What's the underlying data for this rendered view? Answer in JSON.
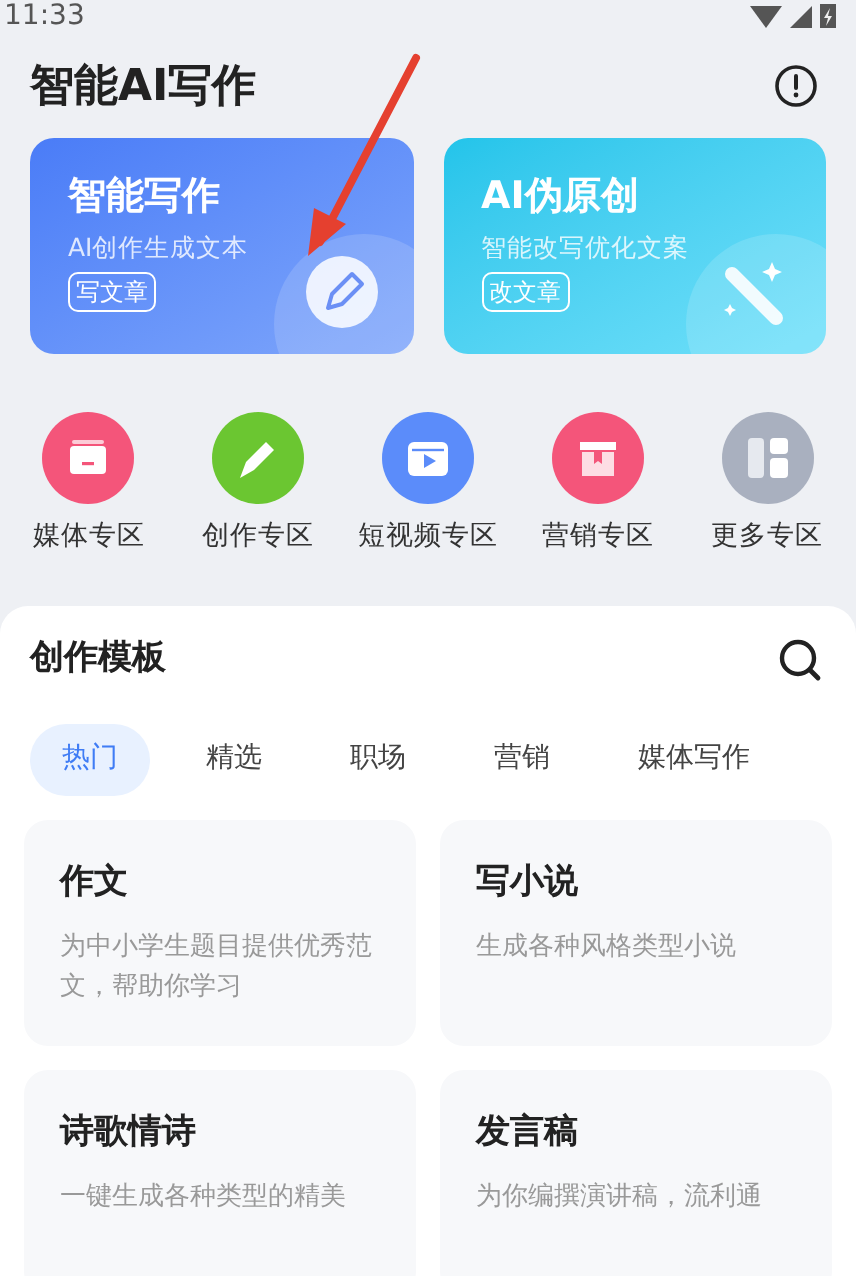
{
  "status_bar": {
    "time": "11:33"
  },
  "header": {
    "title": "智能AI写作"
  },
  "feature_cards": [
    {
      "kind": "write",
      "title": "智能写作",
      "subtitle": "AI创作生成文本",
      "action": "写文章"
    },
    {
      "kind": "rewrite",
      "title": "AI伪原创",
      "subtitle": "智能改写优化文案",
      "action": "改文章"
    }
  ],
  "zones": [
    {
      "kind": "media",
      "label": "媒体专区"
    },
    {
      "kind": "create",
      "label": "创作专区"
    },
    {
      "kind": "video",
      "label": "短视频专区"
    },
    {
      "kind": "marketing",
      "label": "营销专区"
    },
    {
      "kind": "more",
      "label": "更多专区"
    }
  ],
  "templates": {
    "title": "创作模板",
    "tabs": [
      {
        "label": "热门",
        "selected": true
      },
      {
        "label": "精选",
        "selected": false
      },
      {
        "label": "职场",
        "selected": false
      },
      {
        "label": "营销",
        "selected": false
      },
      {
        "label": "媒体写作",
        "selected": false
      }
    ],
    "cards": [
      {
        "title": "作文",
        "description": "为中小学生题目提供优秀范文，帮助你学习"
      },
      {
        "title": "写小说",
        "description": "生成各种风格类型小说"
      },
      {
        "title": "诗歌情诗",
        "description": "一键生成各种类型的精美"
      },
      {
        "title": "发言稿",
        "description": "为你编撰演讲稿，流利通"
      }
    ]
  }
}
